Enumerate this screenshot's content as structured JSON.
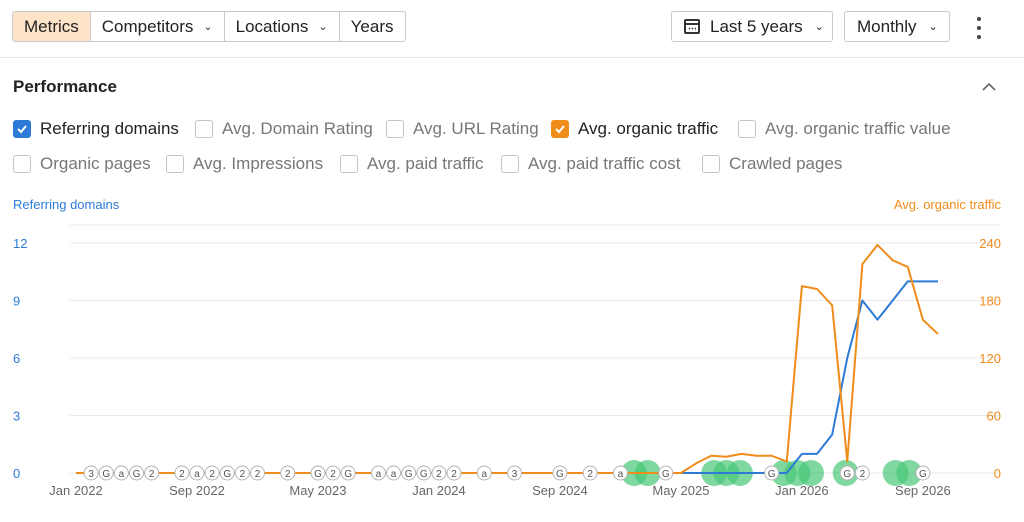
{
  "toolbar": {
    "tabs": [
      {
        "label": "Metrics",
        "active": true,
        "dropdown": false
      },
      {
        "label": "Competitors",
        "active": false,
        "dropdown": true
      },
      {
        "label": "Locations",
        "active": false,
        "dropdown": true
      },
      {
        "label": "Years",
        "active": false,
        "dropdown": false
      }
    ],
    "period_label": "Last 5 years",
    "interval_label": "Monthly",
    "more_icon": "kebab-icon"
  },
  "panel": {
    "title": "Performance",
    "collapse_icon": "chevron-up-icon"
  },
  "metrics": [
    {
      "label": "Referring domains",
      "checked": true,
      "color": "#2d7bd6"
    },
    {
      "label": "Avg. Domain Rating",
      "checked": false
    },
    {
      "label": "Avg. URL Rating",
      "checked": false
    },
    {
      "label": "Avg. organic traffic",
      "checked": true,
      "color": "#f08c1a"
    },
    {
      "label": "Avg. organic traffic value",
      "checked": false
    },
    {
      "label": "Organic pages",
      "checked": false
    },
    {
      "label": "Avg. Impressions",
      "checked": false
    },
    {
      "label": "Avg. paid traffic",
      "checked": false
    },
    {
      "label": "Avg. paid traffic cost",
      "checked": false
    },
    {
      "label": "Crawled pages",
      "checked": false
    }
  ],
  "chart_data": {
    "type": "line",
    "left_axis_title": "Referring domains",
    "right_axis_title": "Avg. organic traffic",
    "left_ticks": [
      "0",
      "3",
      "6",
      "9",
      "12"
    ],
    "right_ticks": [
      "0",
      "60",
      "120",
      "180",
      "240"
    ],
    "left_ylim": [
      0,
      12
    ],
    "right_ylim": [
      0,
      240
    ],
    "x_tick_labels": [
      "Jan 2022",
      "Sep 2022",
      "May 2023",
      "Jan 2024",
      "Sep 2024",
      "May 2025",
      "Jan 2026",
      "Sep 2026"
    ],
    "x_range_months": [
      0,
      58
    ],
    "series": [
      {
        "name": "Referring domains",
        "color": "#2d7bd6",
        "axis": "left",
        "x_months": [
          40,
          41,
          42,
          43,
          44,
          45,
          46,
          47,
          48,
          49,
          50,
          51,
          52,
          53,
          54,
          55,
          56,
          57
        ],
        "values": [
          0,
          0,
          0,
          0,
          0,
          0,
          0,
          0,
          1,
          1,
          2,
          6,
          9,
          8,
          9,
          10,
          10,
          10
        ]
      },
      {
        "name": "Avg. organic traffic",
        "color": "#f08c1a",
        "axis": "right",
        "x_months": [
          0,
          1,
          2,
          3,
          4,
          5,
          6,
          7,
          8,
          9,
          10,
          11,
          12,
          13,
          14,
          15,
          16,
          17,
          18,
          19,
          20,
          21,
          22,
          23,
          24,
          25,
          26,
          27,
          28,
          29,
          30,
          31,
          32,
          33,
          34,
          35,
          36,
          37,
          38,
          39,
          40,
          41,
          42,
          43,
          44,
          45,
          46,
          47,
          48,
          49,
          50,
          51,
          52,
          53,
          54,
          55,
          56,
          57
        ],
        "values": [
          0,
          0,
          0,
          0,
          0,
          0,
          0,
          0,
          0,
          0,
          0,
          0,
          0,
          0,
          0,
          0,
          0,
          0,
          0,
          0,
          0,
          0,
          0,
          0,
          0,
          0,
          0,
          0,
          0,
          0,
          0,
          0,
          0,
          0,
          0,
          0,
          0,
          0,
          0,
          0,
          0,
          10,
          18,
          17,
          20,
          18,
          18,
          12,
          195,
          192,
          175,
          12,
          218,
          238,
          222,
          215,
          160,
          145
        ]
      }
    ],
    "annotations": [
      {
        "x_month": 1,
        "text": "3"
      },
      {
        "x_month": 2,
        "text": "G"
      },
      {
        "x_month": 3,
        "text": "a"
      },
      {
        "x_month": 4,
        "text": "G"
      },
      {
        "x_month": 5,
        "text": "2"
      },
      {
        "x_month": 7,
        "text": "2"
      },
      {
        "x_month": 8,
        "text": "a"
      },
      {
        "x_month": 9,
        "text": "2"
      },
      {
        "x_month": 10,
        "text": "G"
      },
      {
        "x_month": 11,
        "text": "2"
      },
      {
        "x_month": 12,
        "text": "2"
      },
      {
        "x_month": 14,
        "text": "2"
      },
      {
        "x_month": 16,
        "text": "G"
      },
      {
        "x_month": 17,
        "text": "2"
      },
      {
        "x_month": 18,
        "text": "G"
      },
      {
        "x_month": 20,
        "text": "a"
      },
      {
        "x_month": 21,
        "text": "a"
      },
      {
        "x_month": 22,
        "text": "G"
      },
      {
        "x_month": 23,
        "text": "G"
      },
      {
        "x_month": 24,
        "text": "2"
      },
      {
        "x_month": 25,
        "text": "2"
      },
      {
        "x_month": 27,
        "text": "a"
      },
      {
        "x_month": 29,
        "text": "3"
      },
      {
        "x_month": 32,
        "text": "G"
      },
      {
        "x_month": 34,
        "text": "2"
      },
      {
        "x_month": 36,
        "text": "a"
      },
      {
        "x_month": 39,
        "text": "G"
      },
      {
        "x_month": 46,
        "text": "G"
      },
      {
        "x_month": 51,
        "text": "G"
      },
      {
        "x_month": 52,
        "text": "2"
      },
      {
        "x_month": 56,
        "text": "G"
      }
    ],
    "highlights_x_months": [
      36.9,
      37.8,
      42.2,
      43,
      43.9,
      46.8,
      47.7,
      48.6,
      50.9,
      54.2,
      55.1
    ],
    "grid": true
  }
}
